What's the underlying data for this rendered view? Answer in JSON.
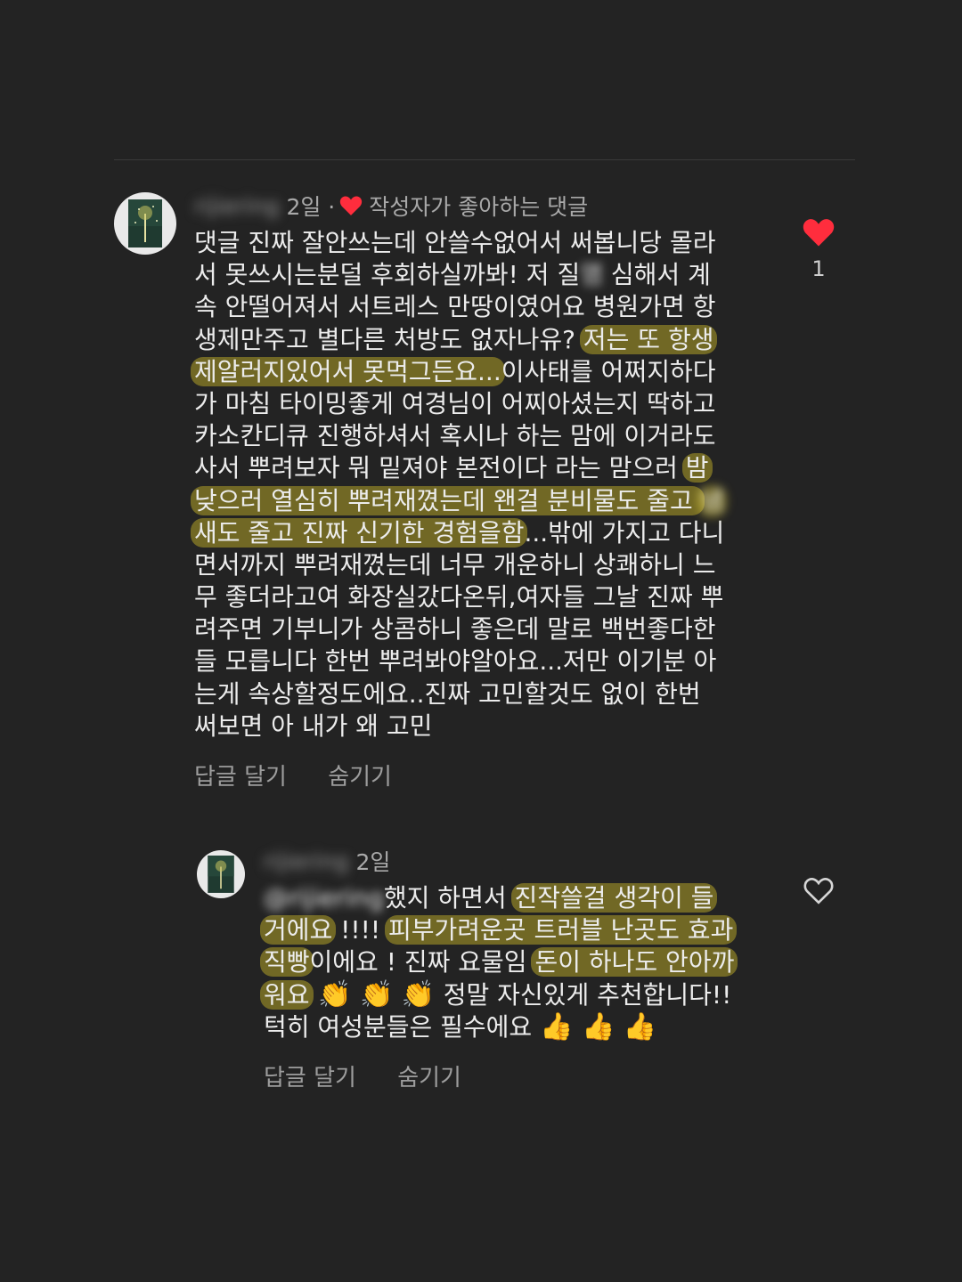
{
  "comment": {
    "username": "rijiering",
    "time": "2일 ·",
    "liked_by_author_label": "작성자가 좋아하는 댓글",
    "like_count": "1",
    "liked": true,
    "lines": [
      [
        {
          "t": "댓글 진짜 잘안쓰는데 안쓸수없어서 써봅니당 몰라"
        }
      ],
      [
        {
          "t": "서 못쓰시는분덜 후회하실까봐! 저 질"
        },
        {
          "t": "염",
          "blur": true
        },
        {
          "t": " 심해서 계"
        }
      ],
      [
        {
          "t": "속 안떨어져서 서트레스 만땅이였어요 병원가면 항"
        }
      ],
      [
        {
          "t": "생제만주고 별다른 처방도 없자나유? "
        },
        {
          "t": "저는 또 항생",
          "hl": true
        }
      ],
      [
        {
          "t": "제알러지있어서 못먹그든요...",
          "hl": true
        },
        {
          "t": "이사태를 어쩌지하다"
        }
      ],
      [
        {
          "t": "가 마침 타이밍좋게 여경님이 어찌아셨는지 딱하고"
        }
      ],
      [
        {
          "t": "카소칸디큐 진행하셔서 혹시나 하는 맘에 이거라도"
        }
      ],
      [
        {
          "t": "사서 뿌려보자 뭐 밑져야 본전이다 라는 맘으러 "
        },
        {
          "t": "밤",
          "hl": true
        }
      ],
      [
        {
          "t": "낮으러 열심히 뿌려재꼈는데 왠걸 분비물도 줄고 ",
          "hl": true
        },
        {
          "t": "냄",
          "hl": true,
          "blur": true
        }
      ],
      [
        {
          "t": "새도 줄고 진짜 신기한 경험을함",
          "hl": true
        },
        {
          "t": "...밖에 가지고 다니"
        }
      ],
      [
        {
          "t": "면서까지 뿌려재꼈는데 너무 개운하니 상쾌하니 느"
        }
      ],
      [
        {
          "t": "무 좋더라고여 화장실갔다온뒤,여자들 그날 진짜 뿌"
        }
      ],
      [
        {
          "t": "려주면 기부니가 상콤하니 좋은데 말로 백번좋다한"
        }
      ],
      [
        {
          "t": "들 모릅니다 한번 뿌려봐야알아요...저만 이기분 아"
        }
      ],
      [
        {
          "t": "는게 속상할정도에요..진짜 고민할것도 없이 한번"
        }
      ],
      [
        {
          "t": "써보면 아 내가 왜 고민"
        }
      ]
    ],
    "reply_label": "답글 달기",
    "hide_label": "숨기기"
  },
  "reply": {
    "username": "rijiering",
    "time": "2일",
    "mention": "@rijiering",
    "liked": false,
    "lines": [
      [
        {
          "t": "@rijiering",
          "blur": true,
          "mention": true
        },
        {
          "t": "했지 하면서 "
        },
        {
          "t": "진작쓸걸 생각이 들",
          "hl": true
        }
      ],
      [
        {
          "t": "거에요",
          "hl": true
        },
        {
          "t": " !!!! "
        },
        {
          "t": "피부가려운곳 트러블 난곳도 효과",
          "hl": true
        }
      ],
      [
        {
          "t": "직빵",
          "hl": true
        },
        {
          "t": "이에요 ! 진짜 요물임 "
        },
        {
          "t": "돈이 하나도 안아까",
          "hl": true
        }
      ],
      [
        {
          "t": "워요",
          "hl": true
        },
        {
          "t": " 👏 👏 👏 ",
          "emoji": true
        },
        {
          "t": "정말 자신있게 추천합니다!!"
        }
      ],
      [
        {
          "t": "턱히 여성분들은 필수에요 "
        },
        {
          "t": "👍 👍 👍",
          "emoji": true
        }
      ]
    ],
    "reply_label": "답글 달기",
    "hide_label": "숨기기"
  },
  "colors": {
    "background": "#232323",
    "highlight": "#dec828",
    "heart_liked": "#ff2d3d"
  },
  "icons": {
    "avatar": "tree-night-avatar",
    "like": "heart-icon"
  }
}
